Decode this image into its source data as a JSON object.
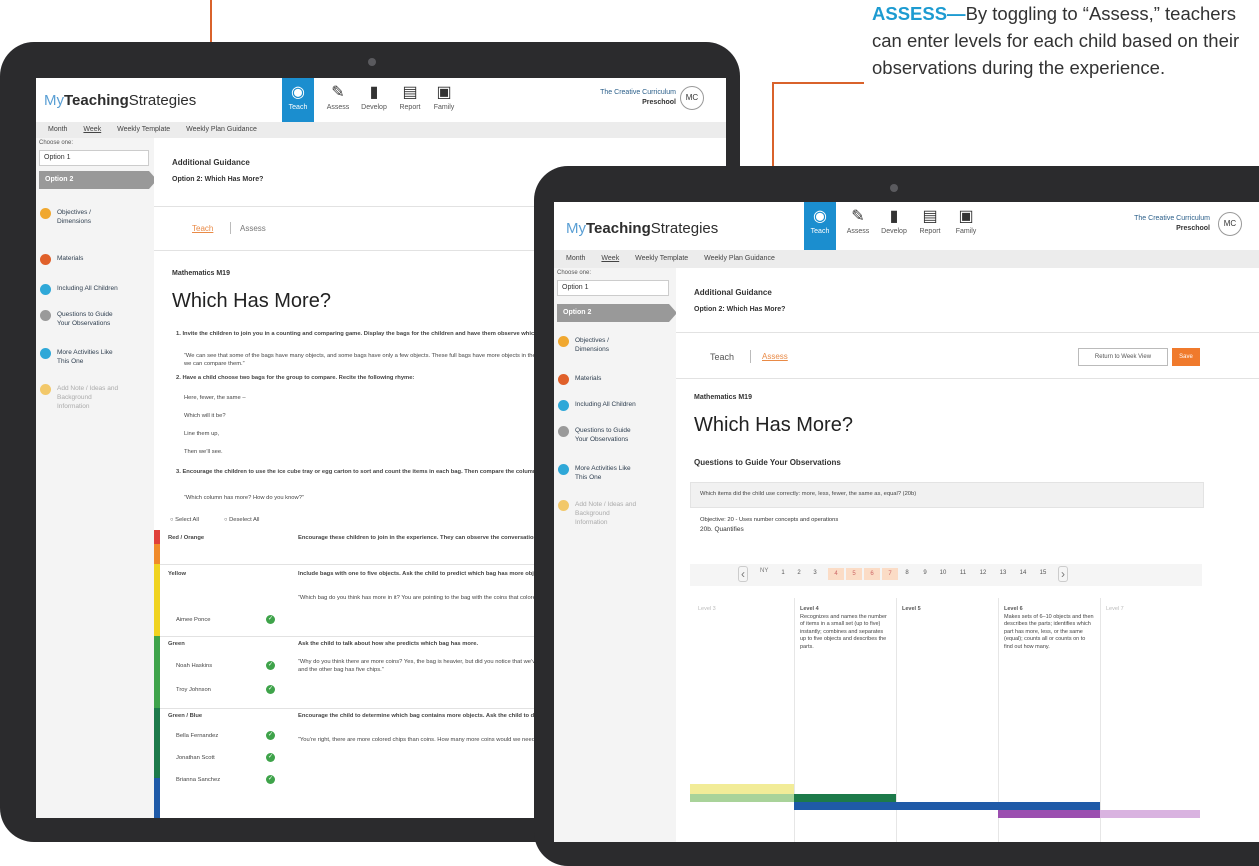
{
  "callout": {
    "heading": "ASSESS—",
    "body": "By toggling to “Assess,” teachers can enter levels for each child based on their observations during the experience."
  },
  "app": {
    "logo_my": "My",
    "logo_bold": "Teaching",
    "logo_rest": "Strategies",
    "nav": [
      {
        "label": "Teach",
        "icon": "apple-icon"
      },
      {
        "label": "Assess",
        "icon": "pencil-icon"
      },
      {
        "label": "Develop",
        "icon": "bar-chart-icon"
      },
      {
        "label": "Report",
        "icon": "report-icon"
      },
      {
        "label": "Family",
        "icon": "family-icon"
      }
    ],
    "curriculum": "The Creative Curriculum",
    "curriculum_sub": "Preschool",
    "avatar": "MC",
    "subnav": [
      "Month",
      "Week",
      "Weekly Template",
      "Weekly Plan Guidance"
    ],
    "choose_one": "Choose one:",
    "option1": "Option 1",
    "option2": "Option 2",
    "sidebar_items": [
      {
        "label": "Objectives / Dimensions",
        "color": "#f0a830"
      },
      {
        "label": "Materials",
        "color": "#e0602a"
      },
      {
        "label": "Including All Children",
        "color": "#2fa8d8"
      },
      {
        "label": "Questions to Guide Your Observations",
        "color": "#7c7c7c"
      },
      {
        "label": "More Activities Like This One",
        "color": "#2fa8d8"
      },
      {
        "label": "Add Note / Ideas and Background Information",
        "color": "#f2c86a"
      }
    ],
    "additional_guidance": "Additional Guidance",
    "option_title": "Option 2: Which Has More?",
    "tab_teach": "Teach",
    "tab_assess": "Assess",
    "course": "Mathematics M19",
    "title": "Which Has More?"
  },
  "left": {
    "steps": [
      "1. Invite the children to join you in a counting and comparing game. Display the bags for the children and have them observe which have more and which have fewer as they examine the bags.",
      "“We can see that some of the bags have many objects, and some bags have only a few objects. These full bags have more objects in them. These other items have fewer objects in them. Let’s see how else we can compare them.”",
      "2. Have a child choose two bags for the group to compare. Recite the following rhyme:",
      "Here, fewer, the same –",
      "Which will it be?",
      "Line them up,",
      "Then we’ll see.",
      "3. Encourage the children to use the ice cube tray or egg carton to sort and count the items in each bag. Then compare the columns and ask questions that prompt the children to talk about it.",
      "“Which column has more? How do you know?”"
    ],
    "select_all": "Select All",
    "deselect_all": "Deselect All",
    "groups": [
      {
        "name": "Red / Orange",
        "color": "#e0403a",
        "guidance": "Encourage these children to join in the experience. They can observe the conversation, and/or observe other children.",
        "children": []
      },
      {
        "name": "Yellow",
        "color": "#f0d320",
        "guidance": "Include bags with one to five objects. Ask the child to predict which bag has more objects. Verify the prediction using the ice cube tray.",
        "note": "“Which bag do you think has more in it? You are pointing to the bag with the coins that colored chips. Let’s put each group into the ice cube tray.”",
        "children": [
          "Aimee Ponce"
        ]
      },
      {
        "name": "Green",
        "color": "#3ea34a",
        "guidance": "Ask the child to talk about how she predicts which bag has more.",
        "note": "“Why do you think there are more coins? Yes, the bag is heavier, but did you notice that we’ve put the objects from each bag in the ice cube tray, we have 5 coins, and the other bag has five chips.”",
        "children": [
          "Noah Haskins",
          "Troy Johnson"
        ]
      },
      {
        "name": "Green / Blue",
        "color": "#1d7a4a",
        "guidance": "Encourage the child to determine which bag contains more objects. Ask the child to determine how many more objects are in the larger set.",
        "note": "“You’re right, there are more colored chips than coins. How many more coins would we need to add to have an equal number of chips and coins?”",
        "children": [
          "Bella Fernandez",
          "Jonathan Scott",
          "Brianna Sanchez"
        ]
      }
    ]
  },
  "right": {
    "return_btn": "Return to Week View",
    "save_btn": "Save",
    "questions_heading": "Questions to Guide Your Observations",
    "question": "Which items did the child use correctly: more, less, fewer, the same as, equal? (20b)",
    "objective": "Objective: 20 - Uses number concepts and operations",
    "sub_objective": "20b. Quantifies",
    "pager": [
      "1",
      "2",
      "3",
      "4",
      "5",
      "6",
      "7",
      "8",
      "9",
      "10",
      "11",
      "12",
      "13",
      "14",
      "15"
    ],
    "levels": [
      {
        "label": "Level 3",
        "desc": ""
      },
      {
        "label": "Level 4",
        "desc": "Recognizes and names the number of items in a small set (up to five) instantly; combines and separates up to five objects and describes the parts."
      },
      {
        "label": "Level 5",
        "desc": ""
      },
      {
        "label": "Level 6",
        "desc": "Makes sets of 6–10 objects and then describes the parts; identifies which part has more, less, or the same (equal); counts all or counts on to find out how many."
      },
      {
        "label": "Level 7",
        "desc": ""
      }
    ],
    "band_colors": [
      "#f2ec98",
      "#a9d39a",
      "#1d7a4a",
      "#1f5aa8",
      "#9b4fb0",
      "#d9b3e0"
    ]
  }
}
